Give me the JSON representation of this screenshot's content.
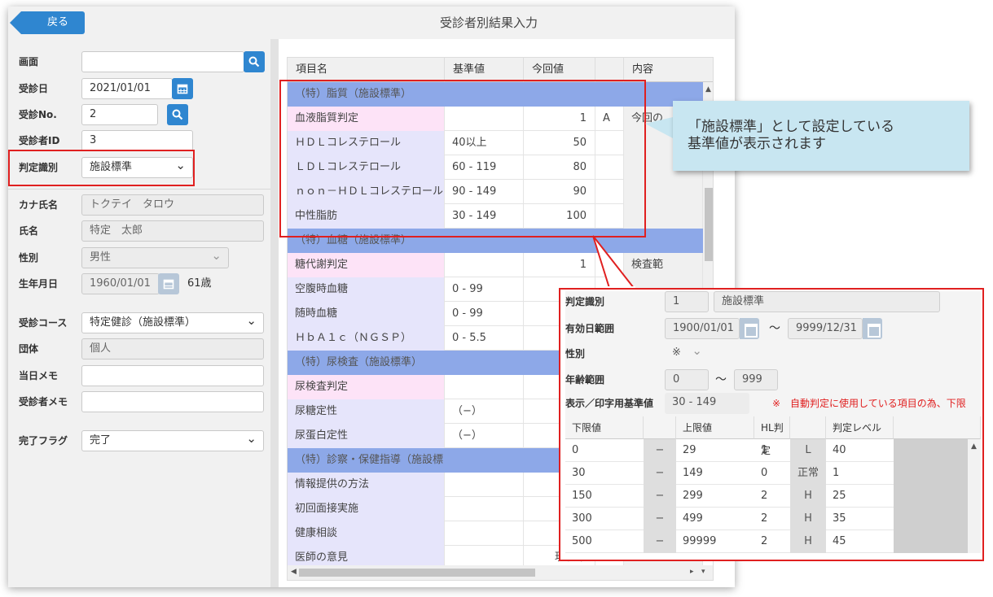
{
  "header": {
    "back_label": "戻る",
    "title": "受診者別結果入力"
  },
  "form": {
    "screen": {
      "label": "画面",
      "value": ""
    },
    "exam_date": {
      "label": "受診日",
      "value": "2021/01/01"
    },
    "exam_no": {
      "label": "受診No.",
      "value": "2"
    },
    "patient_id": {
      "label": "受診者ID",
      "value": "3"
    },
    "judge_type": {
      "label": "判定識別",
      "value": "施設標準"
    },
    "kana_name": {
      "label": "カナ氏名",
      "value": "トクテイ　タロウ"
    },
    "name": {
      "label": "氏名",
      "value": "特定　太郎"
    },
    "sex": {
      "label": "性別",
      "value": "男性"
    },
    "birthdate": {
      "label": "生年月日",
      "value": "1960/01/01",
      "age": "61歳"
    },
    "course": {
      "label": "受診コース",
      "value": "特定健診（施設標準）"
    },
    "group": {
      "label": "団体",
      "value": "個人"
    },
    "day_memo": {
      "label": "当日メモ",
      "value": ""
    },
    "patient_memo": {
      "label": "受診者メモ",
      "value": ""
    },
    "done_flag": {
      "label": "完了フラグ",
      "value": "完了"
    }
  },
  "results_table": {
    "headers": [
      "項目名",
      "基準値",
      "今回値",
      "",
      "内容"
    ],
    "rows": [
      {
        "type": "section",
        "name": "（特）脂質（施設標準）",
        "std": "",
        "val": "",
        "flag": "",
        "content": ""
      },
      {
        "type": "item",
        "style": "pink",
        "name": "血液脂質判定",
        "std": "",
        "val": "1",
        "flag": "A",
        "content": "今回の"
      },
      {
        "type": "item",
        "style": "lav",
        "name": "ＨＤＬコレステロール",
        "std": "40以上",
        "val": "50",
        "flag": "",
        "content": ""
      },
      {
        "type": "item",
        "style": "lav",
        "name": "ＬＤＬコレステロール",
        "std": "60 - 119",
        "val": "80",
        "flag": "",
        "content": ""
      },
      {
        "type": "item",
        "style": "lav",
        "name": "ｎｏｎ－ＨＤＬコレステロール",
        "std": "90 - 149",
        "val": "90",
        "flag": "",
        "content": ""
      },
      {
        "type": "item",
        "style": "lav",
        "name": "中性脂肪",
        "std": "30 - 149",
        "val": "100",
        "flag": "",
        "content": ""
      },
      {
        "type": "section",
        "name": "（特）血糖（施設標準）",
        "std": "",
        "val": "",
        "flag": "",
        "content": ""
      },
      {
        "type": "item",
        "style": "pink",
        "name": "糖代謝判定",
        "std": "",
        "val": "1",
        "flag": "A",
        "content": "検査範"
      },
      {
        "type": "item",
        "style": "lav",
        "name": "空腹時血糖",
        "std": "0 - 99",
        "val": "",
        "flag": "",
        "content": ""
      },
      {
        "type": "item",
        "style": "lav",
        "name": "随時血糖",
        "std": "0 - 99",
        "val": "",
        "flag": "",
        "content": ""
      },
      {
        "type": "item",
        "style": "lav",
        "name": "ＨｂＡ１ｃ（ＮＧＳＰ）",
        "std": "0 - 5.5",
        "val": "",
        "flag": "",
        "content": ""
      },
      {
        "type": "section",
        "name": "（特）尿検査（施設標準）",
        "std": "",
        "val": "",
        "flag": "",
        "content": ""
      },
      {
        "type": "item",
        "style": "pink",
        "name": "尿検査判定",
        "std": "",
        "val": "",
        "flag": "",
        "content": ""
      },
      {
        "type": "item",
        "style": "lav",
        "name": "尿糖定性",
        "std": "（−）",
        "val": "",
        "flag": "",
        "content": ""
      },
      {
        "type": "item",
        "style": "lav",
        "name": "尿蛋白定性",
        "std": "（−）",
        "val": "",
        "flag": "",
        "content": ""
      },
      {
        "type": "section",
        "name": "（特）診察・保健指導（施設標",
        "std": "",
        "val": "",
        "flag": "",
        "content": ""
      },
      {
        "type": "item",
        "style": "lav",
        "name": "情報提供の方法",
        "std": "",
        "val": "",
        "flag": "",
        "content": ""
      },
      {
        "type": "item",
        "style": "lav",
        "name": "初回面接実施",
        "std": "",
        "val": "",
        "flag": "",
        "content": ""
      },
      {
        "type": "item",
        "style": "lav",
        "name": "健康相談",
        "std": "",
        "val": "",
        "flag": "",
        "content": ""
      },
      {
        "type": "item",
        "style": "lav",
        "name": "医師の意見",
        "std": "",
        "val": "現状維",
        "flag": "",
        "content": ""
      }
    ]
  },
  "callout": {
    "line1": "「施設標準」として設定している",
    "line2": "基準値が表示されます"
  },
  "popup": {
    "judge_label": "判定識別",
    "judge_code": "1",
    "judge_name": "施設標準",
    "period_label": "有効日範囲",
    "period_from": "1900/01/01",
    "period_tilde": "～",
    "period_to": "9999/12/31",
    "sex_label": "性別",
    "sex_value": "※",
    "age_label": "年齢範囲",
    "age_from": "0",
    "age_tilde": "～",
    "age_to": "999",
    "disp_label": "表示／印字用基準値",
    "disp_value": "30 - 149",
    "note": "※　自動判定に使用している項目の為、下限",
    "grid_headers": [
      "下限値",
      "",
      "上限値",
      "HL判定",
      "",
      "判定レベル",
      ""
    ],
    "grid_rows": [
      {
        "lo": "0",
        "dash": "−",
        "hi": "29",
        "hl": "1",
        "hl_txt": "L",
        "lvl": "40"
      },
      {
        "lo": "30",
        "dash": "−",
        "hi": "149",
        "hl": "0",
        "hl_txt": "正常",
        "lvl": "1"
      },
      {
        "lo": "150",
        "dash": "−",
        "hi": "299",
        "hl": "2",
        "hl_txt": "H",
        "lvl": "25"
      },
      {
        "lo": "300",
        "dash": "−",
        "hi": "499",
        "hl": "2",
        "hl_txt": "H",
        "lvl": "35"
      },
      {
        "lo": "500",
        "dash": "−",
        "hi": "99999",
        "hl": "2",
        "hl_txt": "H",
        "lvl": "45"
      }
    ]
  },
  "icons": {
    "search": "search-icon",
    "calendar": "calendar-icon",
    "dropdown": "chevron-down-icon"
  },
  "colors": {
    "accent": "#2f86d0",
    "section": "#8da8e8",
    "highlight": "#e02020",
    "callout": "#c8e6f1"
  }
}
